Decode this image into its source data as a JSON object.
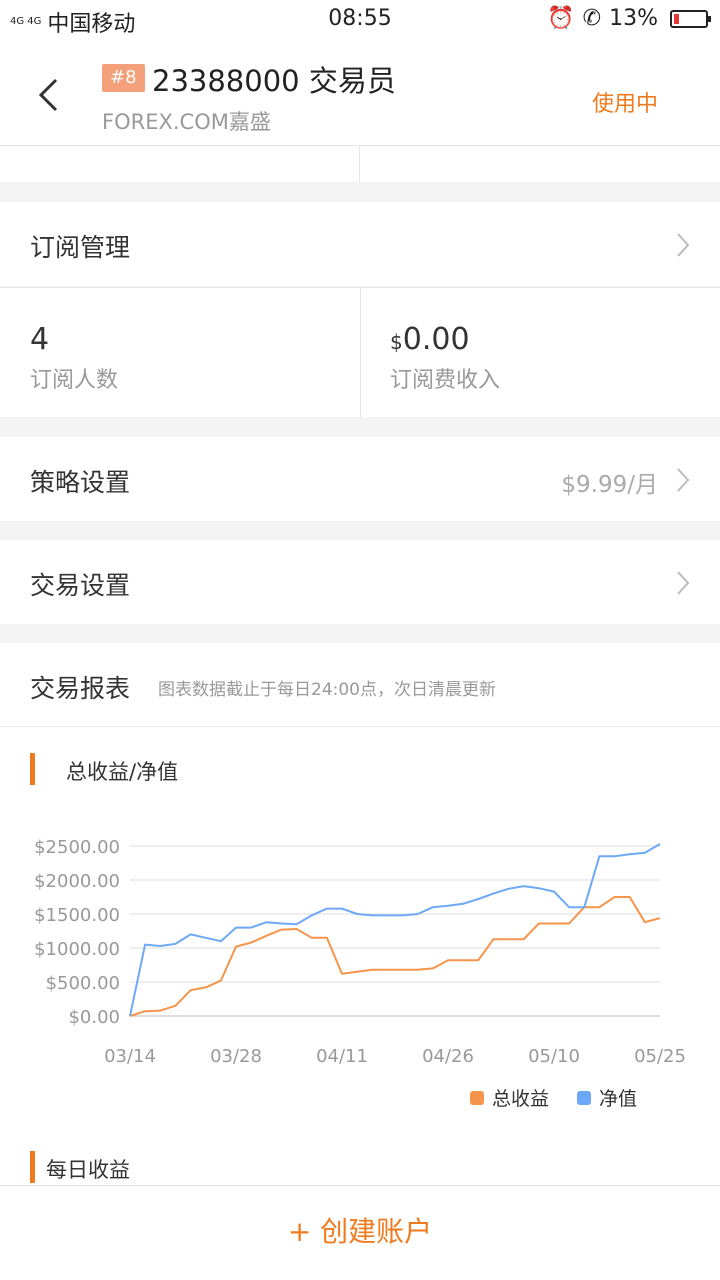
{
  "status_bar": {
    "carrier": "中国移动",
    "signal": "4G 4G",
    "time": "08:55",
    "battery": "13%"
  },
  "header": {
    "rank": "#8",
    "title": "23388000 交易员",
    "broker": "FOREX.COM嘉盛",
    "status": "使用中"
  },
  "subscription": {
    "label": "订阅管理",
    "subscribers_value": "4",
    "subscribers_label": "订阅人数",
    "fee_currency": "$",
    "fee_value": "0.00",
    "fee_label": "订阅费收入"
  },
  "strategy": {
    "label": "策略设置",
    "value": "$9.99/月"
  },
  "trading": {
    "label": "交易设置"
  },
  "report": {
    "title": "交易报表",
    "note": "图表数据截止于每日24:00点，次日清晨更新",
    "section1": "总收益/净值",
    "section2": "每日收益"
  },
  "colors": {
    "accent": "#f07b1e",
    "profit_line": "#f5944a",
    "equity_line": "#6ea8f7"
  },
  "chart_data": {
    "type": "line",
    "x": [
      "03/14",
      "03/16",
      "03/18",
      "03/20",
      "03/22",
      "03/24",
      "03/26",
      "03/28",
      "03/30",
      "04/01",
      "04/03",
      "04/05",
      "04/07",
      "04/09",
      "04/11",
      "04/13",
      "04/15",
      "04/17",
      "04/19",
      "04/21",
      "04/23",
      "04/26",
      "04/28",
      "04/30",
      "05/02",
      "05/04",
      "05/06",
      "05/08",
      "05/10",
      "05/12",
      "05/14",
      "05/16",
      "05/18",
      "05/20",
      "05/22",
      "05/25"
    ],
    "x_tick_labels": [
      "03/14",
      "03/28",
      "04/11",
      "04/26",
      "05/10",
      "05/25"
    ],
    "y_tick_labels": [
      "$0.00",
      "$500.00",
      "$1000.00",
      "$1500.00",
      "$2000.00",
      "$2500.00"
    ],
    "ylim": [
      0,
      2500
    ],
    "grid": true,
    "legend_position": "bottom-right",
    "series": [
      {
        "name": "总收益",
        "color": "#f5944a",
        "values": [
          0,
          70,
          80,
          150,
          380,
          420,
          520,
          1020,
          1080,
          1180,
          1270,
          1280,
          1150,
          1150,
          620,
          650,
          680,
          680,
          680,
          680,
          700,
          820,
          820,
          820,
          1130,
          1130,
          1130,
          1360,
          1360,
          1360,
          1600,
          1600,
          1750,
          1750,
          1380,
          1440
        ]
      },
      {
        "name": "净值",
        "color": "#6ea8f7",
        "values": [
          0,
          1050,
          1030,
          1060,
          1200,
          1150,
          1100,
          1300,
          1300,
          1380,
          1360,
          1350,
          1480,
          1580,
          1580,
          1500,
          1480,
          1480,
          1480,
          1500,
          1600,
          1620,
          1650,
          1720,
          1800,
          1870,
          1910,
          1880,
          1830,
          1600,
          1600,
          2350,
          2350,
          2380,
          2400,
          2530
        ]
      }
    ]
  },
  "bottom": {
    "create_account": "+ 创建账户"
  }
}
